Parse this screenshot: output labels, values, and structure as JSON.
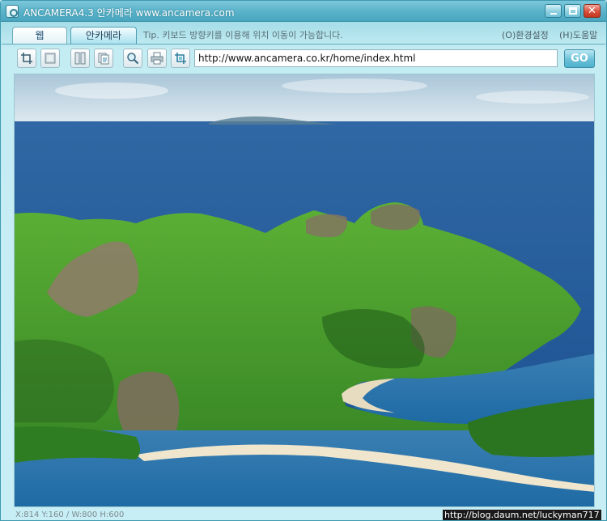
{
  "window": {
    "title": "ANCAMERA4.3 안카메라 www.ancamera.com"
  },
  "tabs": [
    {
      "label": "웹",
      "active": false
    },
    {
      "label": "안카메라",
      "active": true
    }
  ],
  "tip": "Tip. 키보드 방향키를 이용해 위치 이동이 가능합니다.",
  "menu": {
    "settings": "(O)환경설정",
    "help": "(H)도움말"
  },
  "toolbar": {
    "buttons": [
      {
        "icon": "crop-icon"
      },
      {
        "icon": "fullscreen-capture-icon"
      },
      {
        "icon": "split-vertical-icon"
      },
      {
        "icon": "copy-page-icon"
      },
      {
        "icon": "zoom-icon"
      },
      {
        "icon": "print-icon"
      },
      {
        "icon": "trim-icon"
      }
    ],
    "url_value": "http://www.ancamera.co.kr/home/index.html",
    "go_label": "GO"
  },
  "status": {
    "text": "X:814 Y:160 / W:800 H:600"
  },
  "watermark": "http://blog.daum.net/luckyman717",
  "colors": {
    "accent": "#58b2c9",
    "sea": "#1f5f9c",
    "island_green": "#3b9a2a"
  }
}
